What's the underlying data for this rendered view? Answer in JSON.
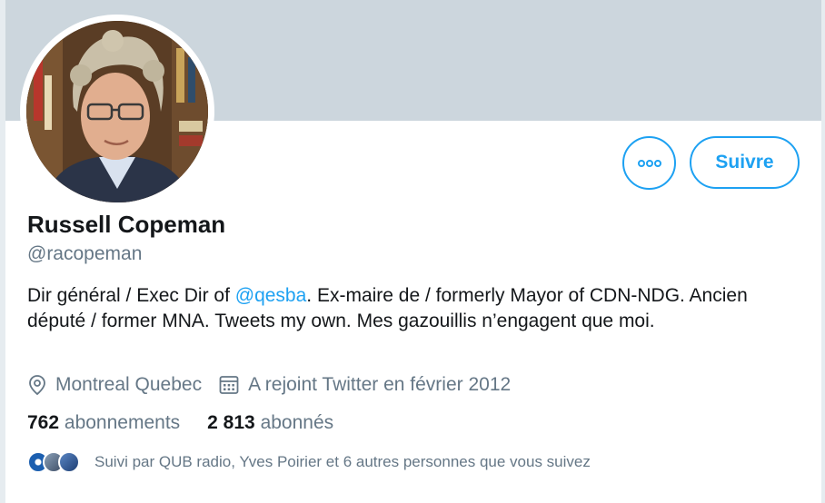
{
  "profile": {
    "name": "Russell Copeman",
    "handle": "@racopeman",
    "bio_part1": "Dir général / Exec Dir of ",
    "bio_mention": "@qesba",
    "bio_part2": ". Ex-maire de / formerly Mayor of CDN-NDG. Ancien député / former MNA. Tweets my own. Mes gazouillis n’engagent que moi.",
    "location": "Montreal Quebec",
    "joined": "A rejoint Twitter en février 2012"
  },
  "actions": {
    "follow_label": "Suivre",
    "more_icon": "more-dots-icon"
  },
  "stats": {
    "following_count": "762",
    "following_label": "abonnements",
    "followers_count": "2 813",
    "followers_label": "abonnés"
  },
  "followed_by": {
    "text": "Suivi par QUB radio, Yves Poirier et 6 autres personnes que vous suivez"
  },
  "colors": {
    "accent": "#1da1f2",
    "banner": "#ccd6dd",
    "muted": "#657786"
  }
}
